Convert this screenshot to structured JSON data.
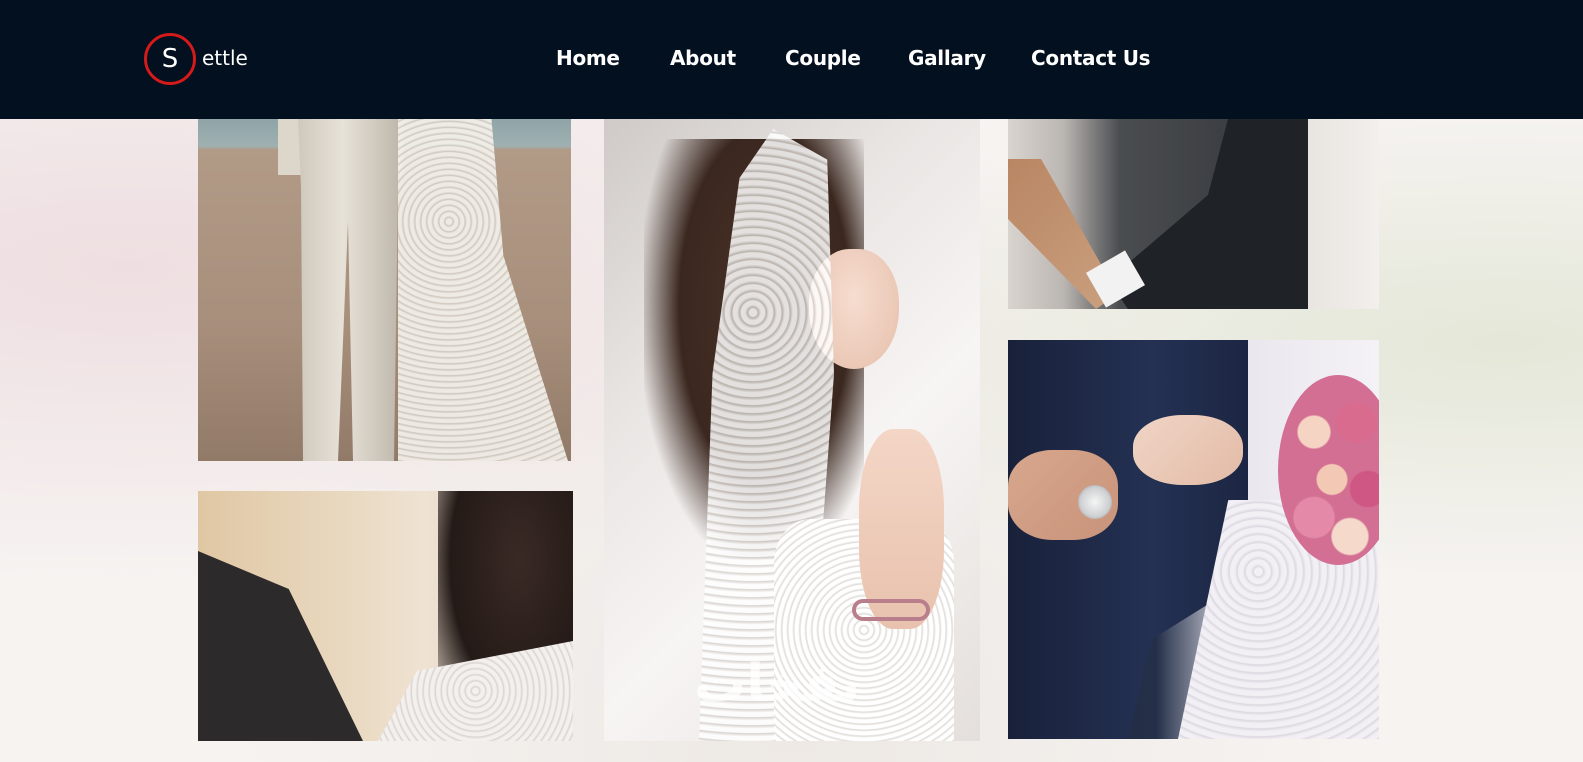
{
  "brand": {
    "logo_letter": "S",
    "logo_text": "ettle",
    "accent_color": "#d41a1a",
    "nav_bg_color": "#03101f"
  },
  "nav": {
    "items": [
      {
        "label": "Home"
      },
      {
        "label": "About"
      },
      {
        "label": "Couple"
      },
      {
        "label": "Gallary"
      },
      {
        "label": "Contact Us"
      }
    ]
  },
  "gallery": {
    "photos": [
      {
        "name": "beach-couple-photo"
      },
      {
        "name": "kissing-couple-photo"
      },
      {
        "name": "bride-veil-photo"
      },
      {
        "name": "groom-hands-photo"
      },
      {
        "name": "arm-in-arm-couple-photo"
      }
    ],
    "watermark_text": "نفخات"
  }
}
